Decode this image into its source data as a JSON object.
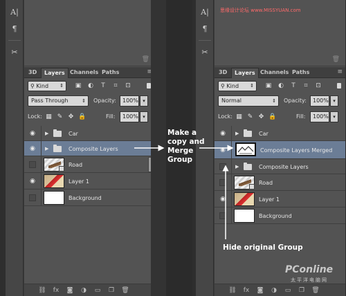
{
  "tabs": [
    "3D",
    "Layers",
    "Channels",
    "Paths"
  ],
  "filter": {
    "kind_label": "Kind",
    "icons": [
      "image-filter-icon",
      "adjustment-filter-icon",
      "type-filter-icon",
      "shape-filter-icon",
      "smart-object-filter-icon"
    ]
  },
  "left": {
    "blend_mode": "Pass Through",
    "opacity_label": "Opacity:",
    "opacity_value": "100%",
    "lock_label": "Lock:",
    "fill_label": "Fill:",
    "fill_value": "100%",
    "layers": [
      {
        "name": "Car",
        "type": "group",
        "visible": true,
        "selected": false
      },
      {
        "name": "Composite Layers",
        "type": "group",
        "visible": true,
        "selected": true
      },
      {
        "name": "Road",
        "type": "smart",
        "visible": false,
        "selected": false
      },
      {
        "name": "Layer 1",
        "type": "layer",
        "visible": true,
        "selected": false
      },
      {
        "name": "Background",
        "type": "background",
        "visible": false,
        "selected": false
      }
    ]
  },
  "right": {
    "blend_mode": "Normal",
    "opacity_label": "Opacity:",
    "opacity_value": "100%",
    "lock_label": "Lock:",
    "fill_label": "Fill:",
    "fill_value": "100%",
    "layers": [
      {
        "name": "Car",
        "type": "group",
        "visible": true,
        "selected": false
      },
      {
        "name": "Composite Layers Merged",
        "type": "layer",
        "visible": true,
        "selected": true
      },
      {
        "name": "Composite Layers",
        "type": "group",
        "visible": false,
        "selected": false
      },
      {
        "name": "Road",
        "type": "smart",
        "visible": false,
        "selected": false
      },
      {
        "name": "Layer 1",
        "type": "layer",
        "visible": true,
        "selected": false
      },
      {
        "name": "Background",
        "type": "background",
        "visible": false,
        "selected": false
      }
    ]
  },
  "annotations": {
    "copy_merge": [
      "Make a",
      "copy and",
      "Merge",
      "Group"
    ],
    "hide_group": "Hide original Group"
  },
  "watermark": {
    "top": "思缘设计论坛 www.MISSYUAN.com",
    "logo": "PConline",
    "logo_sub": "太平洋电脑网"
  },
  "colors": {
    "selected_row": "#6b7d96",
    "panel": "#535353",
    "accent_arrow": "#ffffff"
  }
}
